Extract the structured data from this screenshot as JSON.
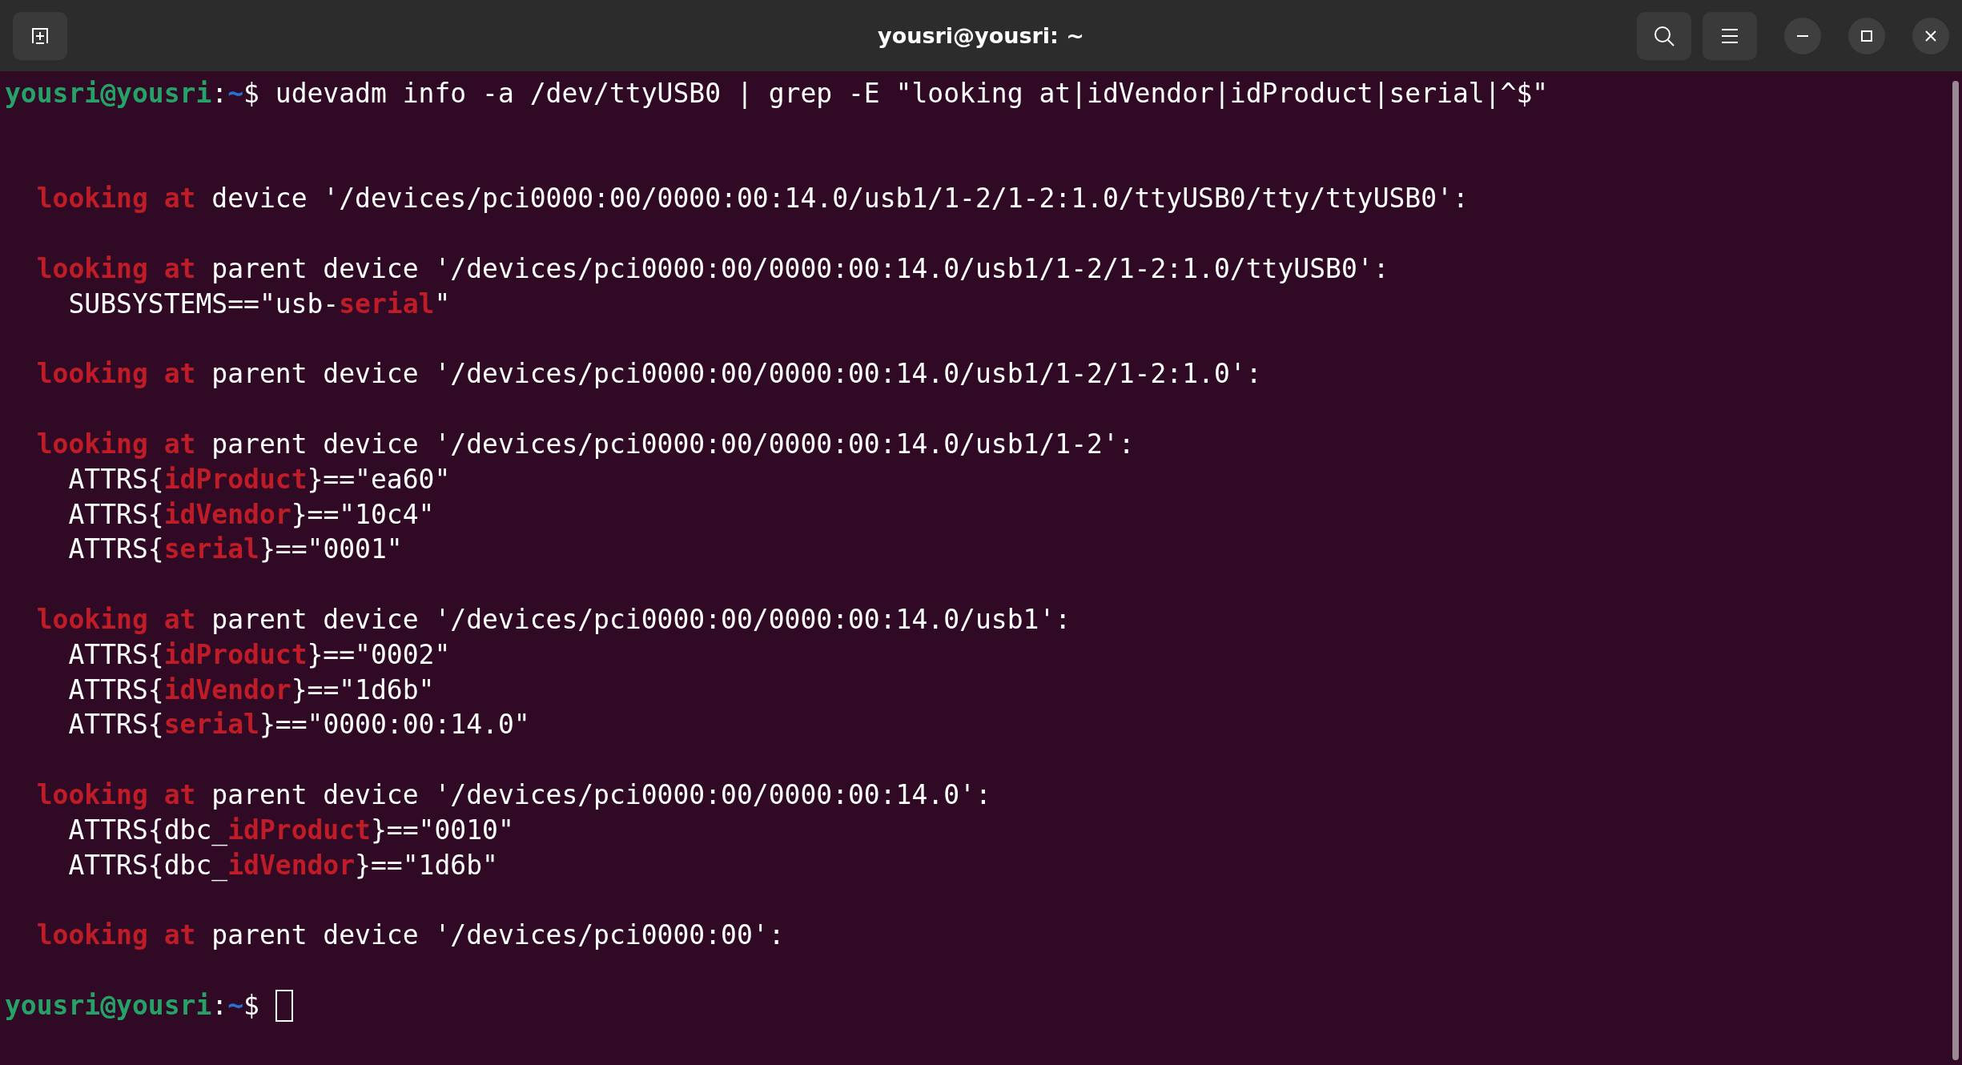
{
  "window": {
    "title": "yousri@yousri: ~"
  },
  "terminal": {
    "lines": [
      {
        "kind": "text",
        "segments": [
          {
            "kind": "user",
            "text": "yousri@yousri"
          },
          {
            "kind": "plain",
            "text": ":"
          },
          {
            "kind": "path",
            "text": "~"
          },
          {
            "kind": "plain",
            "text": "$ udevadm info -a /dev/ttyUSB0 | grep -E \"looking at|idVendor|idProduct|serial|^$\""
          }
        ]
      },
      {
        "kind": "blank"
      },
      {
        "kind": "blank"
      },
      {
        "kind": "heading",
        "segments": [
          {
            "kind": "match",
            "text": "looking at"
          },
          {
            "kind": "plain",
            "text": " device '/devices/pci0000:00/0000:00:14.0/usb1/1-2/1-2:1.0/ttyUSB0/tty/ttyUSB0':"
          }
        ]
      },
      {
        "kind": "blank"
      },
      {
        "kind": "heading",
        "segments": [
          {
            "kind": "match",
            "text": "looking at"
          },
          {
            "kind": "plain",
            "text": " parent device '/devices/pci0000:00/0000:00:14.0/usb1/1-2/1-2:1.0/ttyUSB0':"
          }
        ]
      },
      {
        "kind": "attr",
        "segments": [
          {
            "kind": "plain",
            "text": "SUBSYSTEMS==\"usb-"
          },
          {
            "kind": "match",
            "text": "serial"
          },
          {
            "kind": "plain",
            "text": "\""
          }
        ]
      },
      {
        "kind": "blank"
      },
      {
        "kind": "heading",
        "segments": [
          {
            "kind": "match",
            "text": "looking at"
          },
          {
            "kind": "plain",
            "text": " parent device '/devices/pci0000:00/0000:00:14.0/usb1/1-2/1-2:1.0':"
          }
        ]
      },
      {
        "kind": "blank"
      },
      {
        "kind": "heading",
        "segments": [
          {
            "kind": "match",
            "text": "looking at"
          },
          {
            "kind": "plain",
            "text": " parent device '/devices/pci0000:00/0000:00:14.0/usb1/1-2':"
          }
        ]
      },
      {
        "kind": "attr",
        "segments": [
          {
            "kind": "plain",
            "text": "ATTRS{"
          },
          {
            "kind": "match",
            "text": "idProduct"
          },
          {
            "kind": "plain",
            "text": "}==\"ea60\""
          }
        ]
      },
      {
        "kind": "attr",
        "segments": [
          {
            "kind": "plain",
            "text": "ATTRS{"
          },
          {
            "kind": "match",
            "text": "idVendor"
          },
          {
            "kind": "plain",
            "text": "}==\"10c4\""
          }
        ]
      },
      {
        "kind": "attr",
        "segments": [
          {
            "kind": "plain",
            "text": "ATTRS{"
          },
          {
            "kind": "match",
            "text": "serial"
          },
          {
            "kind": "plain",
            "text": "}==\"0001\""
          }
        ]
      },
      {
        "kind": "blank"
      },
      {
        "kind": "heading",
        "segments": [
          {
            "kind": "match",
            "text": "looking at"
          },
          {
            "kind": "plain",
            "text": " parent device '/devices/pci0000:00/0000:00:14.0/usb1':"
          }
        ]
      },
      {
        "kind": "attr",
        "segments": [
          {
            "kind": "plain",
            "text": "ATTRS{"
          },
          {
            "kind": "match",
            "text": "idProduct"
          },
          {
            "kind": "plain",
            "text": "}==\"0002\""
          }
        ]
      },
      {
        "kind": "attr",
        "segments": [
          {
            "kind": "plain",
            "text": "ATTRS{"
          },
          {
            "kind": "match",
            "text": "idVendor"
          },
          {
            "kind": "plain",
            "text": "}==\"1d6b\""
          }
        ]
      },
      {
        "kind": "attr",
        "segments": [
          {
            "kind": "plain",
            "text": "ATTRS{"
          },
          {
            "kind": "match",
            "text": "serial"
          },
          {
            "kind": "plain",
            "text": "}==\"0000:00:14.0\""
          }
        ]
      },
      {
        "kind": "blank"
      },
      {
        "kind": "heading",
        "segments": [
          {
            "kind": "match",
            "text": "looking at"
          },
          {
            "kind": "plain",
            "text": " parent device '/devices/pci0000:00/0000:00:14.0':"
          }
        ]
      },
      {
        "kind": "attr",
        "segments": [
          {
            "kind": "plain",
            "text": "ATTRS{dbc_"
          },
          {
            "kind": "match",
            "text": "idProduct"
          },
          {
            "kind": "plain",
            "text": "}==\"0010\""
          }
        ]
      },
      {
        "kind": "attr",
        "segments": [
          {
            "kind": "plain",
            "text": "ATTRS{dbc_"
          },
          {
            "kind": "match",
            "text": "idVendor"
          },
          {
            "kind": "plain",
            "text": "}==\"1d6b\""
          }
        ]
      },
      {
        "kind": "blank"
      },
      {
        "kind": "heading",
        "segments": [
          {
            "kind": "match",
            "text": "looking at"
          },
          {
            "kind": "plain",
            "text": " parent device '/devices/pci0000:00':"
          }
        ]
      },
      {
        "kind": "blank"
      },
      {
        "kind": "prompt",
        "segments": [
          {
            "kind": "user",
            "text": "yousri@yousri"
          },
          {
            "kind": "plain",
            "text": ":"
          },
          {
            "kind": "path",
            "text": "~"
          },
          {
            "kind": "plain",
            "text": "$ "
          }
        ]
      }
    ]
  }
}
